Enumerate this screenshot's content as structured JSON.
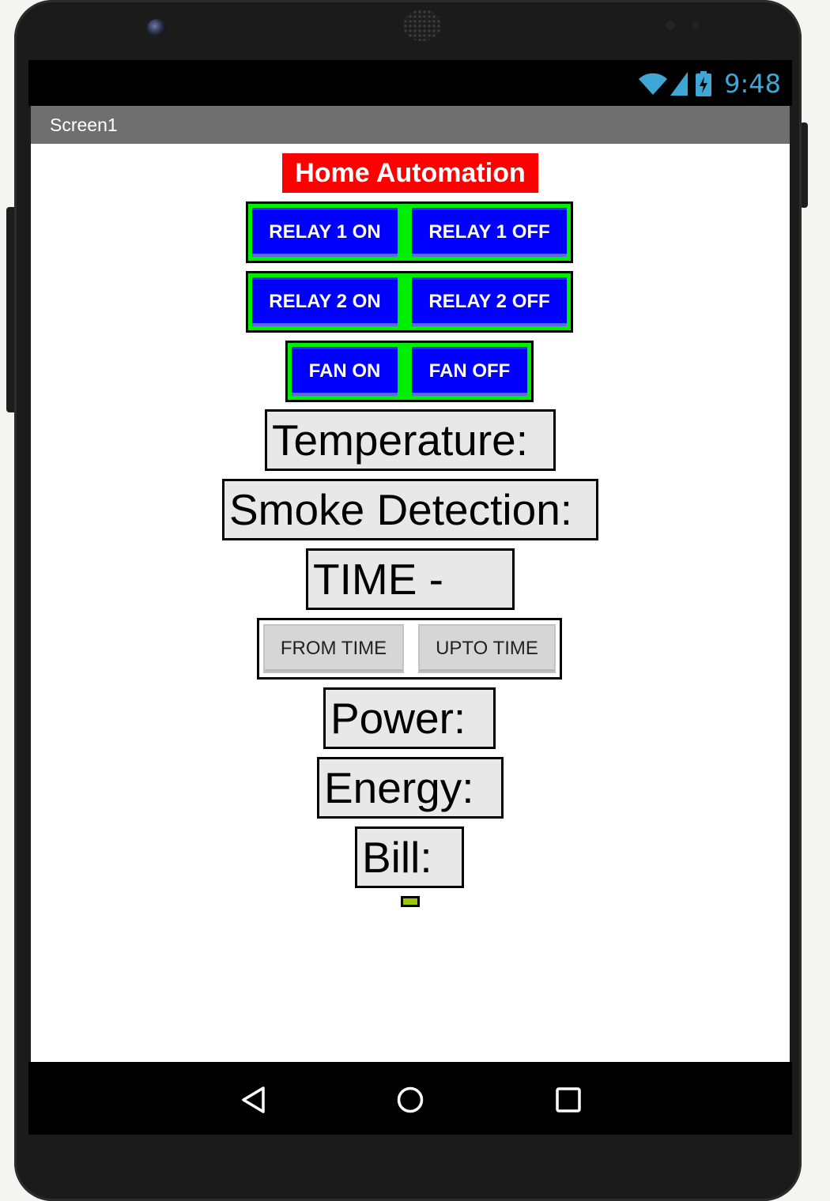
{
  "status_bar": {
    "time": "9:48",
    "icons": [
      "wifi-icon",
      "signal-icon",
      "battery-charging-icon"
    ],
    "icon_color": "#3ea7d6"
  },
  "title_bar": {
    "title": "Screen1"
  },
  "app": {
    "heading": "Home Automation",
    "relay1": {
      "on_label": "RELAY 1 ON",
      "off_label": "RELAY 1 OFF"
    },
    "relay2": {
      "on_label": "RELAY 2 ON",
      "off_label": "RELAY 2 OFF"
    },
    "fan": {
      "on_label": "FAN ON",
      "off_label": "FAN OFF"
    },
    "temperature_label": "Temperature:",
    "smoke_label": "Smoke Detection:",
    "time_label": "TIME -",
    "from_time_label": "FROM TIME",
    "upto_time_label": "UPTO TIME",
    "power_label": "Power:",
    "energy_label": "Energy:",
    "bill_label": "Bill:"
  },
  "colors": {
    "heading_bg": "#ff0000",
    "button_blue": "#0000ff",
    "row_green": "#00ee00",
    "label_bg": "#e8e8e8",
    "indicator": "#9ac70a"
  },
  "nav_bar": {
    "icons": [
      "back-icon",
      "home-icon",
      "recents-icon"
    ]
  }
}
